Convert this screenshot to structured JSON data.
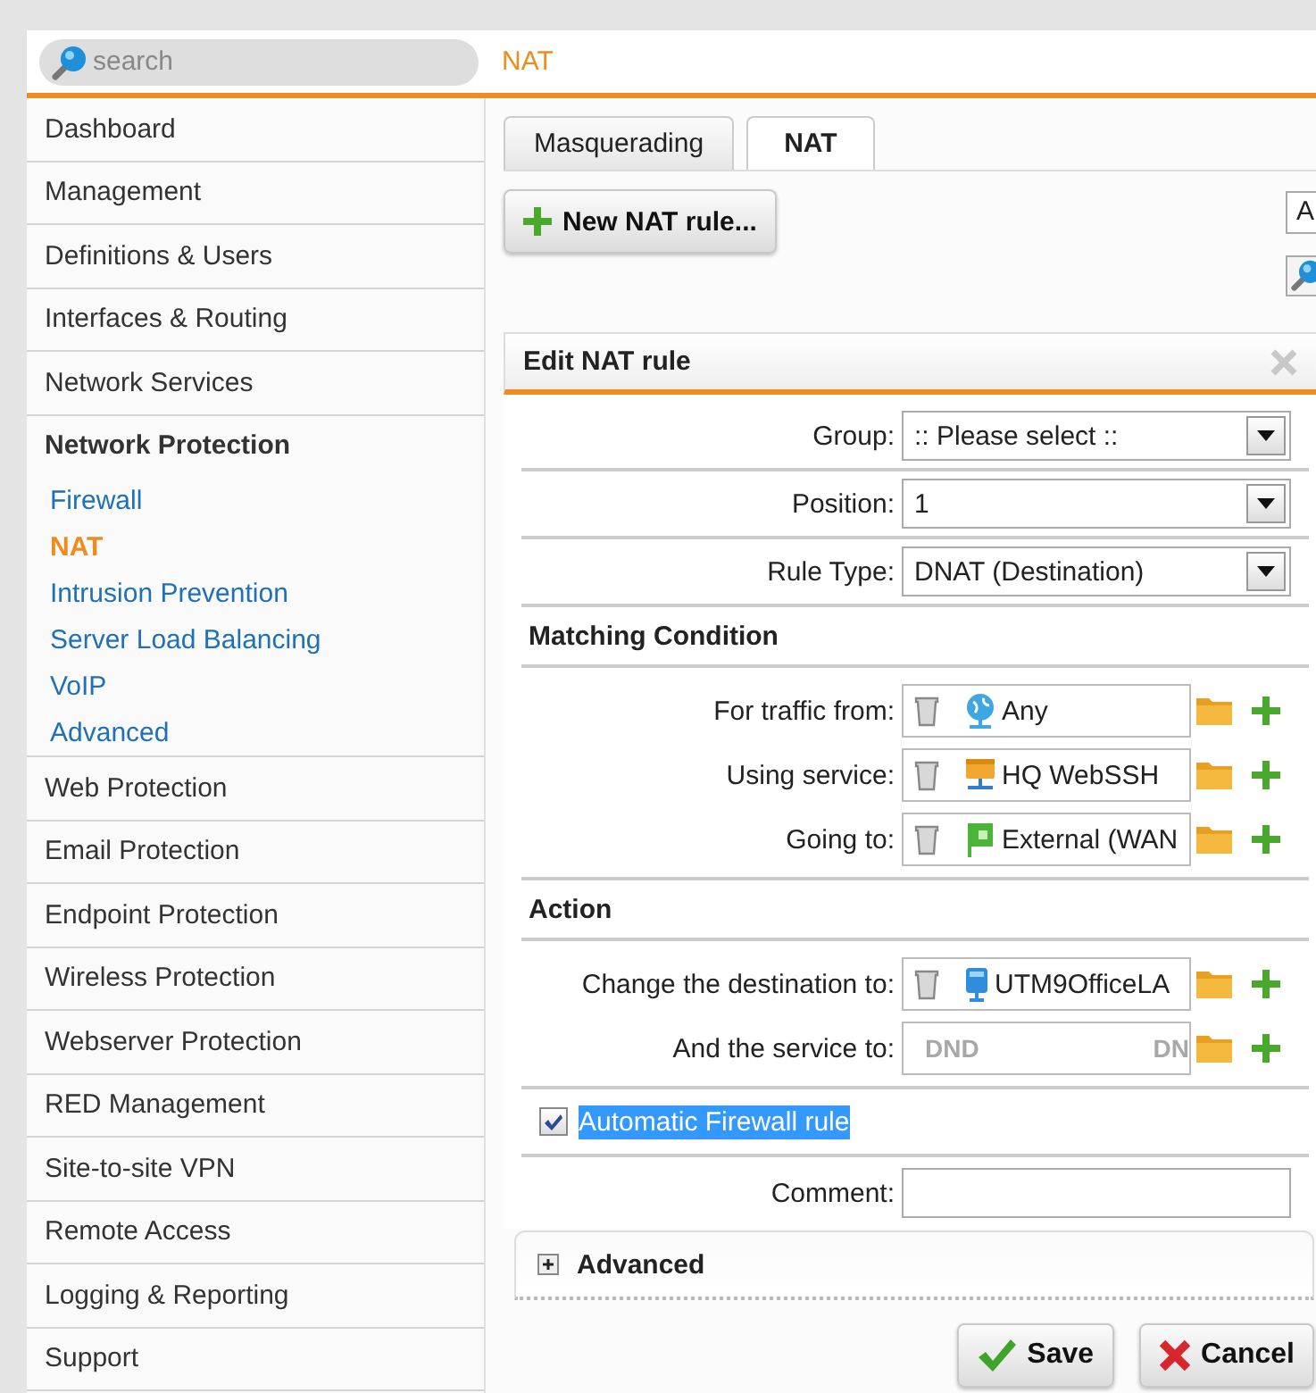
{
  "search": {
    "placeholder": "search"
  },
  "breadcrumb": "NAT",
  "sidebar": {
    "items": [
      {
        "label": "Dashboard",
        "expanded": false
      },
      {
        "label": "Management",
        "expanded": false
      },
      {
        "label": "Definitions & Users",
        "expanded": false
      },
      {
        "label": "Interfaces & Routing",
        "expanded": false
      },
      {
        "label": "Network Services",
        "expanded": false
      },
      {
        "label": "Network Protection",
        "expanded": true,
        "children": [
          {
            "label": "Firewall",
            "selected": false
          },
          {
            "label": "NAT",
            "selected": true
          },
          {
            "label": "Intrusion Prevention",
            "selected": false
          },
          {
            "label": "Server Load Balancing",
            "selected": false
          },
          {
            "label": "VoIP",
            "selected": false
          },
          {
            "label": "Advanced",
            "selected": false
          }
        ]
      },
      {
        "label": "Web Protection",
        "expanded": false
      },
      {
        "label": "Email Protection",
        "expanded": false
      },
      {
        "label": "Endpoint Protection",
        "expanded": false
      },
      {
        "label": "Wireless Protection",
        "expanded": false
      },
      {
        "label": "Webserver Protection",
        "expanded": false
      },
      {
        "label": "RED Management",
        "expanded": false
      },
      {
        "label": "Site-to-site VPN",
        "expanded": false
      },
      {
        "label": "Remote Access",
        "expanded": false
      },
      {
        "label": "Logging & Reporting",
        "expanded": false
      },
      {
        "label": "Support",
        "expanded": false
      }
    ]
  },
  "tabs": [
    {
      "label": "Masquerading",
      "selected": false
    },
    {
      "label": "NAT",
      "selected": true
    }
  ],
  "toolbar": {
    "new_button": "New NAT rule...",
    "filter_field": {
      "value": "A"
    }
  },
  "dialog": {
    "title": "Edit NAT rule",
    "rows": [
      {
        "kind": "select",
        "label": "Group:",
        "value": ":: Please select ::"
      },
      {
        "kind": "select",
        "label": "Position:",
        "value": "1"
      },
      {
        "kind": "select",
        "label": "Rule Type:",
        "value": "DNAT (Destination)"
      },
      {
        "kind": "heading",
        "text": "Matching Condition"
      },
      {
        "kind": "network_object",
        "label": "For traffic from:",
        "value": "Any"
      },
      {
        "kind": "service_object",
        "label": "Using service:",
        "value": "HQ WebSSH"
      },
      {
        "kind": "interface_object",
        "label": "Going to:",
        "value": "External (WAN"
      },
      {
        "kind": "heading",
        "text": "Action"
      },
      {
        "kind": "host_object",
        "label": "Change the destination to:",
        "value": "UTM9OfficeLA"
      },
      {
        "kind": "drop_target",
        "label": "And the service to:",
        "hints": [
          "DND",
          "DN"
        ]
      },
      {
        "kind": "checkbox",
        "label": "Automatic Firewall rule",
        "checked": true,
        "highlighted": true
      },
      {
        "kind": "text",
        "label": "Comment:"
      }
    ],
    "advanced": {
      "label": "Advanced",
      "expanded": false
    },
    "buttons": [
      {
        "kind": "save",
        "label": "Save"
      },
      {
        "kind": "cancel",
        "label": "Cancel"
      }
    ]
  }
}
